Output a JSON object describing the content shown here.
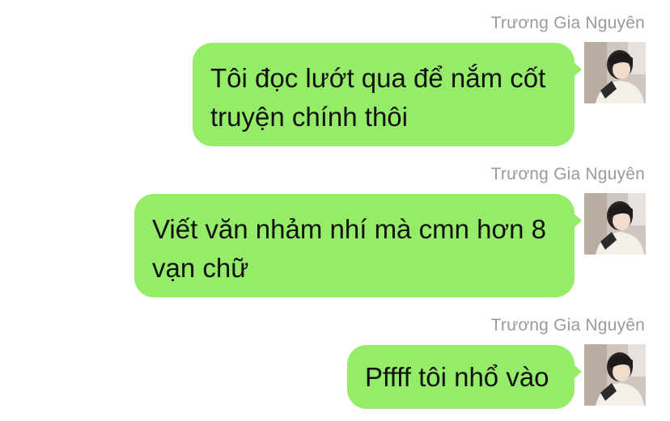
{
  "messages": [
    {
      "sender": "Trương Gia Nguyên",
      "text": "Tôi đọc lướt qua để nắm cốt truyện chính thôi",
      "avatar_icon": "user-avatar-icon"
    },
    {
      "sender": "Trương Gia Nguyên",
      "text": "Viết văn nhảm nhí mà cmn hơn 8 vạn chữ",
      "avatar_icon": "user-avatar-icon"
    },
    {
      "sender": "Trương Gia Nguyên",
      "text": "Pffff tôi nhổ vào",
      "avatar_icon": "user-avatar-icon"
    }
  ],
  "colors": {
    "bubble": "#95ec69",
    "sender_text": "#9a9a9a",
    "message_text": "#111111",
    "background": "#ffffff"
  }
}
